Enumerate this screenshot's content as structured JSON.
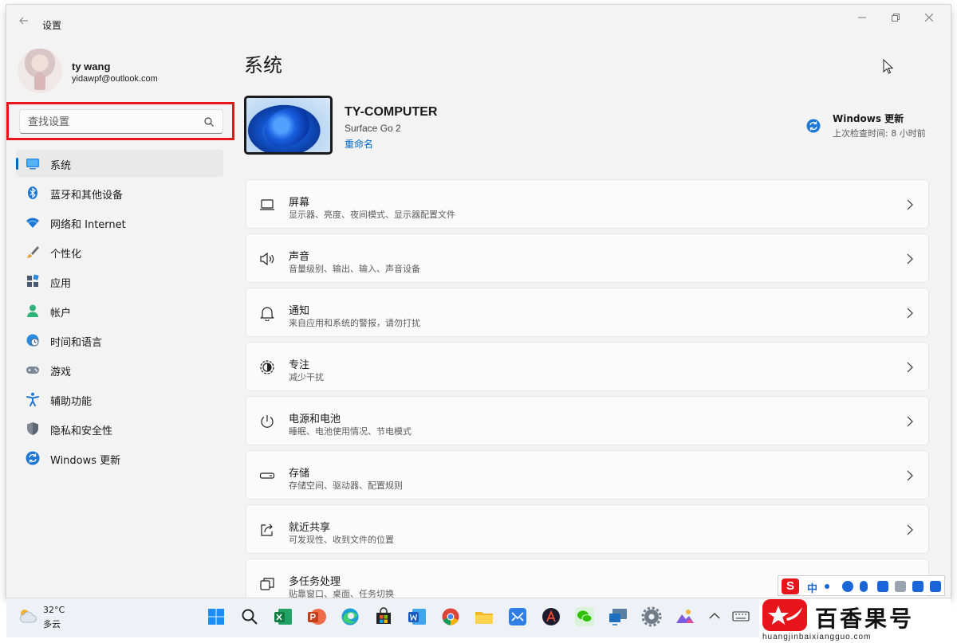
{
  "window": {
    "app_title": "设置",
    "controls": [
      "minimize",
      "maximize",
      "close"
    ]
  },
  "profile": {
    "name": "ty wang",
    "email": "yidawpf@outlook.com"
  },
  "search": {
    "placeholder": "查找设置"
  },
  "sidebar": {
    "items": [
      {
        "label": "系统",
        "icon": "monitor-icon",
        "active": true
      },
      {
        "label": "蓝牙和其他设备",
        "icon": "bluetooth-icon"
      },
      {
        "label": "网络和 Internet",
        "icon": "wifi-icon"
      },
      {
        "label": "个性化",
        "icon": "brush-icon"
      },
      {
        "label": "应用",
        "icon": "apps-icon"
      },
      {
        "label": "帐户",
        "icon": "person-icon"
      },
      {
        "label": "时间和语言",
        "icon": "globe-clock-icon"
      },
      {
        "label": "游戏",
        "icon": "gamepad-icon"
      },
      {
        "label": "辅助功能",
        "icon": "accessibility-icon"
      },
      {
        "label": "隐私和安全性",
        "icon": "shield-icon"
      },
      {
        "label": "Windows 更新",
        "icon": "update-icon"
      }
    ]
  },
  "main": {
    "title": "系统",
    "device": {
      "name": "TY-COMPUTER",
      "model": "Surface Go 2",
      "rename": "重命名"
    },
    "windows_update": {
      "title": "Windows 更新",
      "last_checked": "上次检查时间: 8 小时前"
    },
    "cards": [
      {
        "title": "屏幕",
        "desc": "显示器、亮度、夜间模式、显示器配置文件",
        "icon": "display-icon"
      },
      {
        "title": "声音",
        "desc": "音量级别、输出、输入、声音设备",
        "icon": "speaker-icon"
      },
      {
        "title": "通知",
        "desc": "来自应用和系统的警报，请勿打扰",
        "icon": "bell-icon"
      },
      {
        "title": "专注",
        "desc": "减少干扰",
        "icon": "focus-icon"
      },
      {
        "title": "电源和电池",
        "desc": "睡眠、电池使用情况、节电模式",
        "icon": "power-icon"
      },
      {
        "title": "存储",
        "desc": "存储空间、驱动器、配置规则",
        "icon": "storage-icon"
      },
      {
        "title": "就近共享",
        "desc": "可发现性、收到文件的位置",
        "icon": "share-icon"
      },
      {
        "title": "多任务处理",
        "desc": "贴靠窗口、桌面、任务切换",
        "icon": "multitask-icon"
      }
    ]
  },
  "taskbar": {
    "weather": {
      "temp": "32°C",
      "desc": "多云"
    },
    "apps": [
      "windows-start-icon",
      "search-icon",
      "excel-icon",
      "powerpoint-icon",
      "edge-icon",
      "store-icon",
      "word-icon",
      "chrome-icon",
      "file-explorer-icon",
      "mail-icon",
      "app-icon",
      "wechat-icon",
      "remote-desktop-icon",
      "settings-icon",
      "photos-icon"
    ],
    "tray": [
      "chevron-up-icon",
      "keyboard-icon"
    ]
  },
  "ime": {
    "logo": "S",
    "lang": "中"
  },
  "brand": {
    "name": "百香果号",
    "domain": "huangjinbaixiangguo.com"
  },
  "colors": {
    "accent": "#0067c0",
    "highlight": "#e8141b"
  }
}
